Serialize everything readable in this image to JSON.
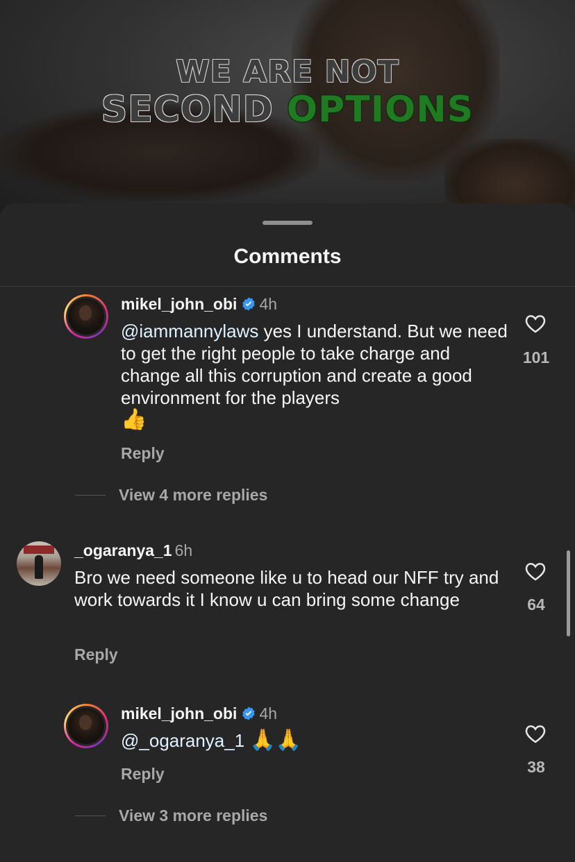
{
  "video": {
    "caption_line1": "WE ARE NOT",
    "caption_line2_white": "SECOND",
    "caption_line2_green": "OPTIONS"
  },
  "sheet": {
    "title": "Comments"
  },
  "comments": [
    {
      "username": "mikel_john_obi",
      "verified": true,
      "time": "4h",
      "mention": "@iammannylaws",
      "text": " yes I understand. But we need to get the right people to take charge and change all this corruption and create a good environment for the players",
      "emoji": "👍",
      "reply_label": "Reply",
      "likes": "101",
      "more_replies": "View 4 more replies"
    },
    {
      "username": "_ogaranya_1",
      "verified": false,
      "time": "6h",
      "text": "Bro we need someone like u to head our NFF try and work towards it I know u can bring some change",
      "reply_label": "Reply",
      "likes": "64"
    },
    {
      "username": "mikel_john_obi",
      "verified": true,
      "time": "4h",
      "mention": "@_ogaranya_1",
      "emoji": "🙏🙏",
      "reply_label": "Reply",
      "likes": "38",
      "more_replies": "View 3 more replies"
    }
  ],
  "colors": {
    "background": "#262626",
    "text": "#f5f5f5",
    "secondary": "#a8a8a8",
    "verified": "#3897f0",
    "caption_green": "#1f7a22"
  }
}
